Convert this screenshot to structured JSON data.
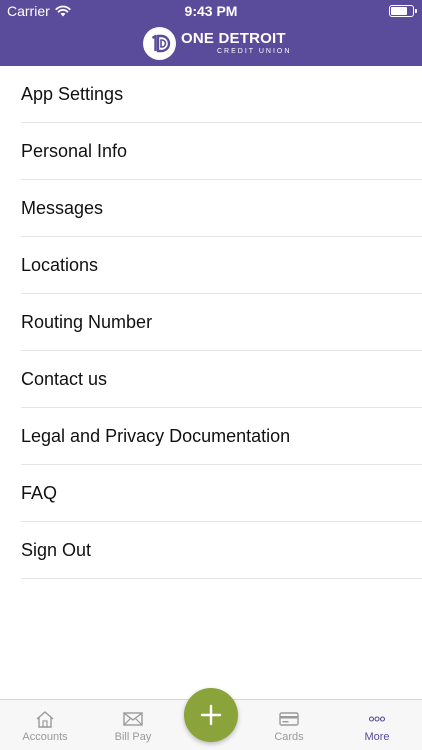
{
  "status_bar": {
    "carrier": "Carrier",
    "time": "9:43 PM"
  },
  "brand": {
    "name": "ONE DETROIT",
    "subtitle": "CREDIT UNION"
  },
  "menu": {
    "items": [
      {
        "label": "App Settings"
      },
      {
        "label": "Personal Info"
      },
      {
        "label": "Messages"
      },
      {
        "label": "Locations"
      },
      {
        "label": "Routing Number"
      },
      {
        "label": "Contact us"
      },
      {
        "label": "Legal and Privacy Documentation"
      },
      {
        "label": "FAQ"
      },
      {
        "label": "Sign Out"
      }
    ]
  },
  "tabbar": {
    "tabs": [
      {
        "label": "Accounts",
        "icon": "house-icon",
        "active": false
      },
      {
        "label": "Bill Pay",
        "icon": "envelope-icon",
        "active": false
      },
      {
        "label": "Cards",
        "icon": "card-icon",
        "active": false
      },
      {
        "label": "More",
        "icon": "ellipsis-icon",
        "active": true
      }
    ],
    "fab_icon": "plus-icon"
  },
  "colors": {
    "header": "#5a4b9b",
    "fab": "#8aa33a",
    "active_tab": "#5a4b9b",
    "inactive_tab": "#9a9a9a"
  }
}
